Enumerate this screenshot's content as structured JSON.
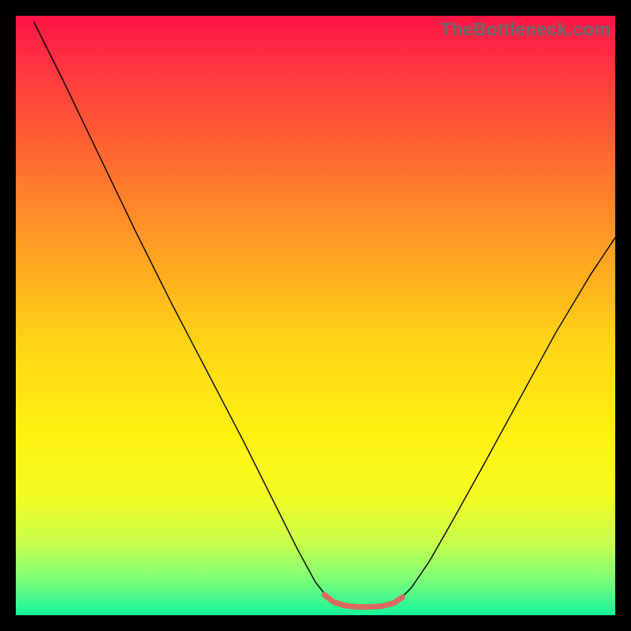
{
  "watermark": {
    "text": "TheBottleneck.com"
  },
  "chart_data": {
    "type": "line",
    "title": "",
    "xlabel": "",
    "ylabel": "",
    "xlim": [
      0,
      100
    ],
    "ylim": [
      0,
      100
    ],
    "grid": false,
    "gradient_stops": [
      {
        "offset": 0.0,
        "color": "#ff1447"
      },
      {
        "offset": 0.1,
        "color": "#ff3a3f"
      },
      {
        "offset": 0.25,
        "color": "#ff6f2f"
      },
      {
        "offset": 0.4,
        "color": "#ffa321"
      },
      {
        "offset": 0.55,
        "color": "#ffd516"
      },
      {
        "offset": 0.7,
        "color": "#fff210"
      },
      {
        "offset": 0.8,
        "color": "#f4fb23"
      },
      {
        "offset": 0.88,
        "color": "#c7ff4a"
      },
      {
        "offset": 0.94,
        "color": "#7dff7a"
      },
      {
        "offset": 1.0,
        "color": "#17f59b"
      }
    ],
    "series": [
      {
        "name": "curve",
        "color": "#000000",
        "stroke_width": 1.4,
        "points": [
          {
            "x": 3.0,
            "y": 99.0
          },
          {
            "x": 8.0,
            "y": 89.0
          },
          {
            "x": 14.0,
            "y": 76.5
          },
          {
            "x": 20.0,
            "y": 64.0
          },
          {
            "x": 26.0,
            "y": 52.0
          },
          {
            "x": 32.0,
            "y": 40.5
          },
          {
            "x": 38.0,
            "y": 29.0
          },
          {
            "x": 43.0,
            "y": 19.0
          },
          {
            "x": 47.0,
            "y": 11.0
          },
          {
            "x": 50.0,
            "y": 5.5
          },
          {
            "x": 52.0,
            "y": 3.0
          },
          {
            "x": 54.0,
            "y": 1.7
          },
          {
            "x": 56.0,
            "y": 1.3
          },
          {
            "x": 58.0,
            "y": 1.3
          },
          {
            "x": 60.0,
            "y": 1.3
          },
          {
            "x": 62.0,
            "y": 1.6
          },
          {
            "x": 64.0,
            "y": 2.6
          },
          {
            "x": 66.0,
            "y": 4.6
          },
          {
            "x": 69.0,
            "y": 9.0
          },
          {
            "x": 73.0,
            "y": 16.0
          },
          {
            "x": 78.0,
            "y": 25.0
          },
          {
            "x": 84.0,
            "y": 36.0
          },
          {
            "x": 90.0,
            "y": 47.0
          },
          {
            "x": 96.0,
            "y": 57.0
          },
          {
            "x": 100.0,
            "y": 63.0
          }
        ]
      },
      {
        "name": "minimum-marker",
        "color": "#dd6860",
        "stroke_width": 7,
        "linecap": "round",
        "points": [
          {
            "x": 51.5,
            "y": 3.4
          },
          {
            "x": 53.0,
            "y": 2.2
          },
          {
            "x": 55.0,
            "y": 1.6
          },
          {
            "x": 57.0,
            "y": 1.4
          },
          {
            "x": 59.0,
            "y": 1.4
          },
          {
            "x": 61.0,
            "y": 1.5
          },
          {
            "x": 63.0,
            "y": 2.0
          },
          {
            "x": 64.5,
            "y": 3.0
          }
        ]
      }
    ]
  }
}
